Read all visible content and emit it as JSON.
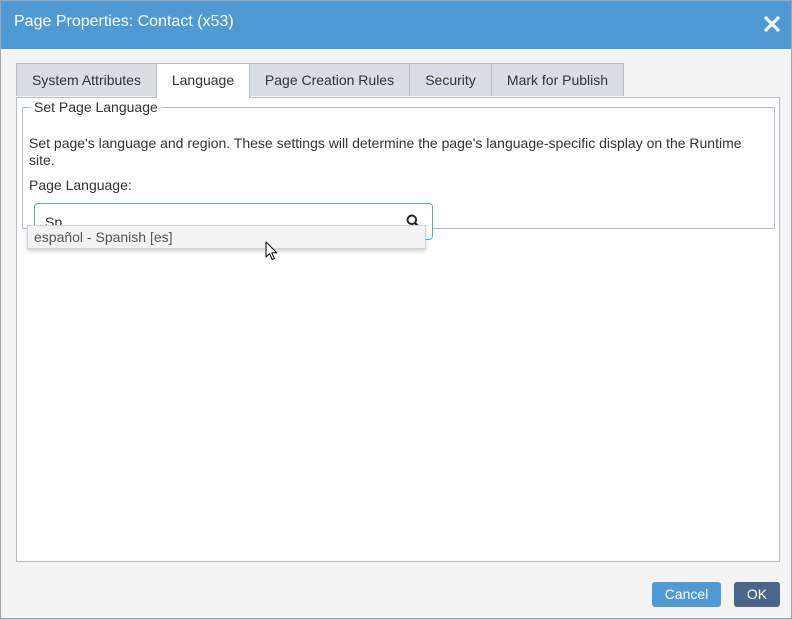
{
  "dialog": {
    "title": "Page Properties: Contact (x53)",
    "close_icon": "close-x-icon"
  },
  "tabs": [
    {
      "label": "System Attributes",
      "active": false
    },
    {
      "label": "Language",
      "active": true
    },
    {
      "label": "Page Creation Rules",
      "active": false
    },
    {
      "label": "Security",
      "active": false
    },
    {
      "label": "Mark for Publish",
      "active": false
    }
  ],
  "language_group": {
    "legend": "Set Page Language",
    "description": "Set page's language and region. These settings will determine the page's language-specific display on the Runtime site.",
    "field_label": "Page Language:",
    "search": {
      "value": "Sp",
      "icon": "magnifier-icon"
    },
    "suggestions": [
      "español - Spanish [es]"
    ]
  },
  "buttons": {
    "cancel": "Cancel",
    "ok": "OK"
  },
  "colors": {
    "titlebar": "#4f9ad4",
    "cancel_button": "#4f9ad4",
    "ok_button": "#4a6688"
  }
}
